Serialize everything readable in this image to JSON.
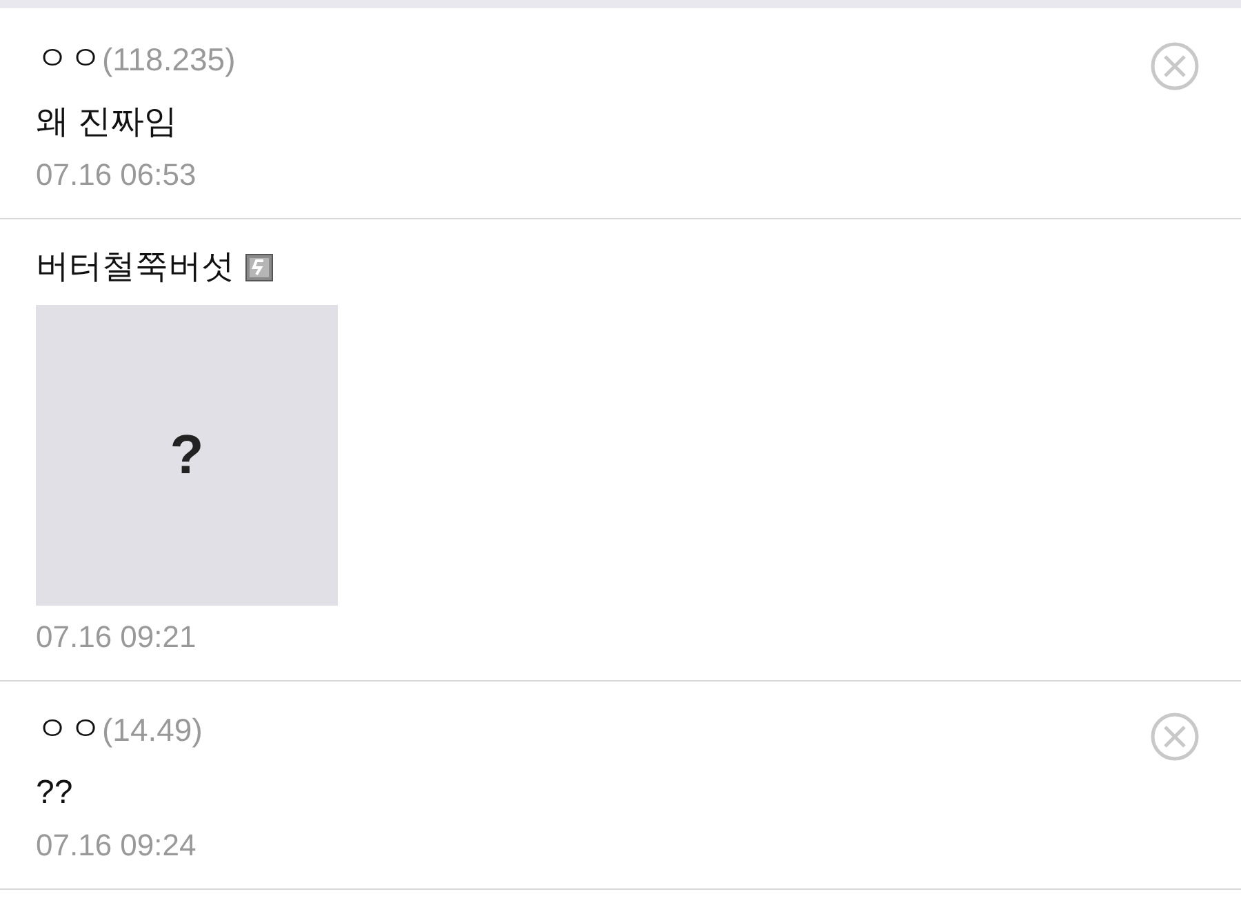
{
  "comments": [
    {
      "kind": "text",
      "name": "ㅇㅇ",
      "ip": "(118.235)",
      "member_badge": false,
      "text": "왜 진짜임",
      "date": "07.16 06:53",
      "deletable": true
    },
    {
      "kind": "image",
      "name": "버터철쭉버섯",
      "member_badge": true,
      "image_placeholder": "?",
      "date": "07.16 09:21",
      "deletable": false
    },
    {
      "kind": "text",
      "name": "ㅇㅇ",
      "ip": "(14.49)",
      "member_badge": false,
      "text": "??",
      "date": "07.16 09:24",
      "deletable": true
    }
  ]
}
